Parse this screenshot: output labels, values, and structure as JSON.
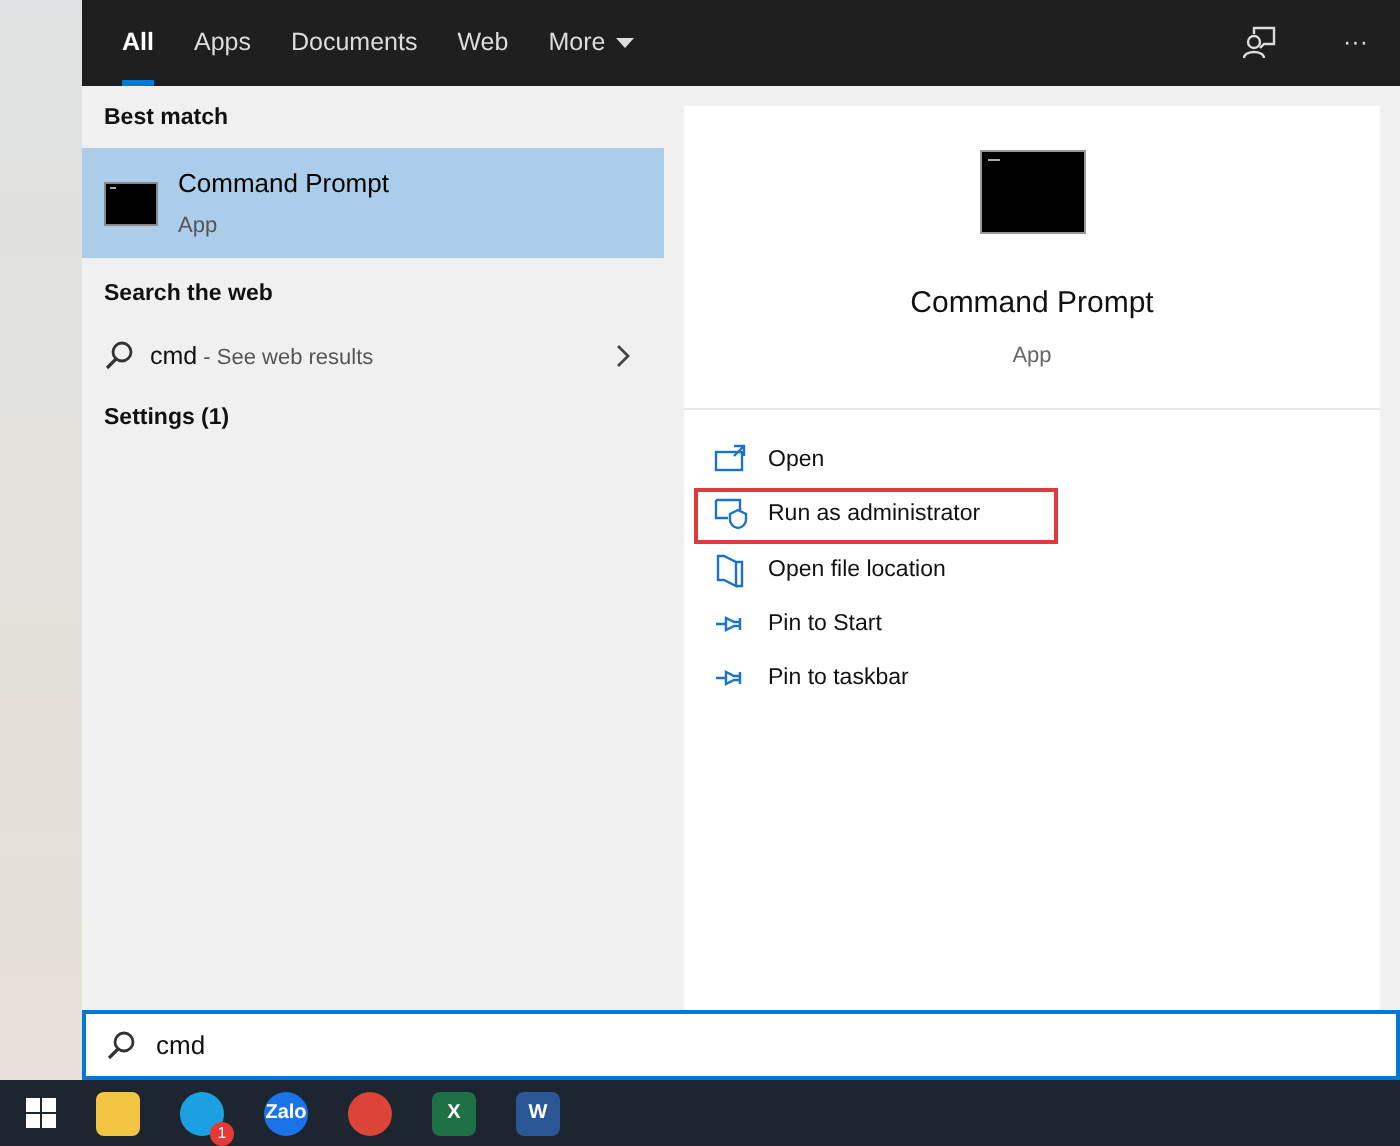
{
  "tabs": [
    {
      "label": "All",
      "selected": true
    },
    {
      "label": "Apps",
      "selected": false
    },
    {
      "label": "Documents",
      "selected": false
    },
    {
      "label": "Web",
      "selected": false
    },
    {
      "label": "More",
      "selected": false,
      "dropdown": true
    }
  ],
  "toolbar": {
    "more": "···"
  },
  "results": {
    "best_match_heading": "Best match",
    "best_match": {
      "title": "Command Prompt",
      "subtitle": "App",
      "selected": true
    },
    "web_heading": "Search the web",
    "web_result": {
      "query": "cmd",
      "hint": " - See web results"
    },
    "settings_heading": "Settings (1)"
  },
  "preview": {
    "title": "Command Prompt",
    "subtitle": "App",
    "actions": [
      {
        "kind": "open",
        "label": "Open",
        "highlighted": false
      },
      {
        "kind": "admin",
        "label": "Run as administrator",
        "highlighted": true
      },
      {
        "kind": "folder",
        "label": "Open file location",
        "highlighted": false
      },
      {
        "kind": "pin",
        "label": "Pin to Start",
        "highlighted": false
      },
      {
        "kind": "pin",
        "label": "Pin to taskbar",
        "highlighted": false
      }
    ]
  },
  "search": {
    "value": "cmd"
  },
  "taskbar": [
    {
      "kind": "explorer"
    },
    {
      "kind": "skype",
      "badge": "1"
    },
    {
      "kind": "zalo",
      "label": "Zalo"
    },
    {
      "kind": "chrome"
    },
    {
      "kind": "excel",
      "label": "X"
    },
    {
      "kind": "word",
      "label": "W"
    }
  ]
}
